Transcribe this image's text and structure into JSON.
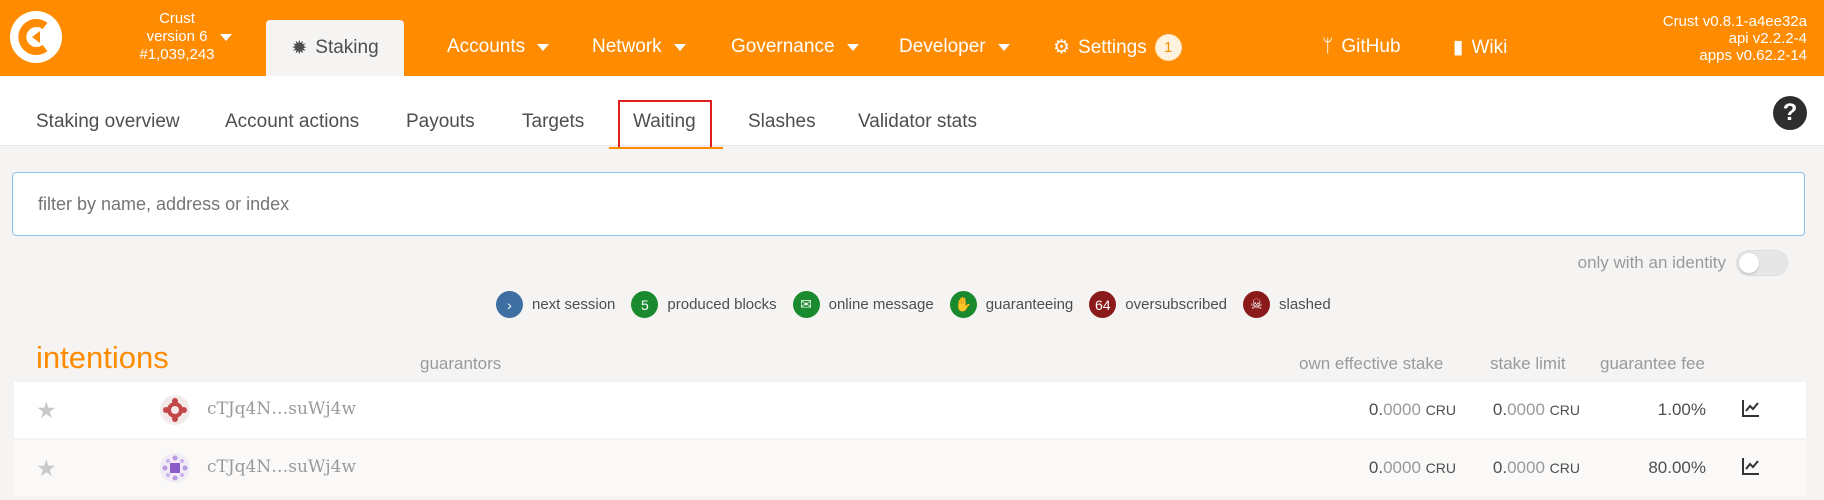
{
  "chain": {
    "name": "Crust",
    "version": "version 6",
    "block": "#1,039,243"
  },
  "nav": {
    "staking": "Staking",
    "accounts": "Accounts",
    "network": "Network",
    "governance": "Governance",
    "developer": "Developer",
    "settings": "Settings",
    "settings_badge": "1",
    "github": "GitHub",
    "wiki": "Wiki"
  },
  "versions": {
    "node": "Crust v0.8.1-a4ee32a",
    "api": "api v2.2.2-4",
    "apps": "apps v0.62.2-14"
  },
  "subtabs": [
    "Staking overview",
    "Account actions",
    "Payouts",
    "Targets",
    "Waiting",
    "Slashes",
    "Validator stats"
  ],
  "active_subtab": "Waiting",
  "filter": {
    "placeholder": "filter by name, address or index",
    "value": ""
  },
  "identity_toggle": {
    "label": "only with an identity",
    "on": false
  },
  "legend": [
    {
      "icon": "chevron-right-icon",
      "badge": "",
      "color": "#3e6fa3",
      "label": "next session"
    },
    {
      "icon": "",
      "badge": "5",
      "color": "#1a8a2e",
      "label": "produced blocks"
    },
    {
      "icon": "envelope-icon",
      "badge": "",
      "color": "#1a8a2e",
      "label": "online message"
    },
    {
      "icon": "hand-icon",
      "badge": "",
      "color": "#1a8a2e",
      "label": "guaranteeing"
    },
    {
      "icon": "",
      "badge": "64",
      "color": "#8b1a1a",
      "label": "oversubscribed"
    },
    {
      "icon": "skull-icon",
      "badge": "",
      "color": "#8b1a1a",
      "label": "slashed"
    }
  ],
  "table": {
    "title": "intentions",
    "columns": {
      "guarantors": "guarantors",
      "own_stake": "own effective stake",
      "stake_limit": "stake limit",
      "fee": "guarantee fee"
    },
    "rows": [
      {
        "address": "cTJq4N…suWj4w",
        "own_int": "0.",
        "own_dec": "0000",
        "own_unit": "CRU",
        "limit_int": "0.",
        "limit_dec": "0000",
        "limit_unit": "CRU",
        "fee": "1.00%"
      },
      {
        "address": "cTJq4N…suWj4w",
        "own_int": "0.",
        "own_dec": "0000",
        "own_unit": "CRU",
        "limit_int": "0.",
        "limit_dec": "0000",
        "limit_unit": "CRU",
        "fee": "80.00%"
      }
    ]
  },
  "colors": {
    "brand": "#ff8c00",
    "highlight_box": "#e02020"
  }
}
